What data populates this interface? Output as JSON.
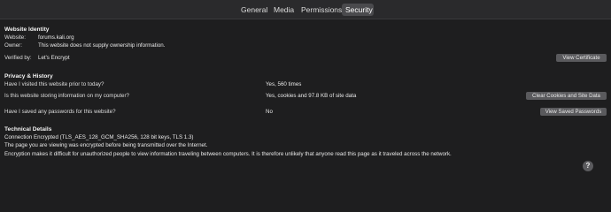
{
  "tabs": [
    {
      "label": "General"
    },
    {
      "label": "Media"
    },
    {
      "label": "Permissions"
    },
    {
      "label": "Security"
    }
  ],
  "identity": {
    "title": "Website Identity",
    "website_label": "Website:",
    "website_value": "forums.kali.org",
    "owner_label": "Owner:",
    "owner_value": "This website does not supply ownership information.",
    "verified_label": "Verified by:",
    "verified_value": "Let's Encrypt",
    "view_certificate_label": "View Certificate"
  },
  "privacy": {
    "title": "Privacy & History",
    "q1": "Have I visited this website prior to today?",
    "a1": "Yes, 560 times",
    "q2": "Is this website storing information on my computer?",
    "a2": "Yes, cookies and 97.8 KB of site data",
    "clear_label": "Clear Cookies and Site Data",
    "q3": "Have I saved any passwords for this website?",
    "a3": "No",
    "view_passwords_label": "View Saved Passwords"
  },
  "technical": {
    "title": "Technical Details",
    "line1": "Connection Encrypted (TLS_AES_128_GCM_SHA256, 128 bit keys, TLS 1.3)",
    "line2": "The page you are viewing was encrypted before being transmitted over the Internet.",
    "line3": "Encryption makes it difficult for unauthorized people to view information traveling between computers. It is therefore unlikely that anyone read this page as it traveled across the network."
  },
  "help": {
    "glyph": "?"
  }
}
